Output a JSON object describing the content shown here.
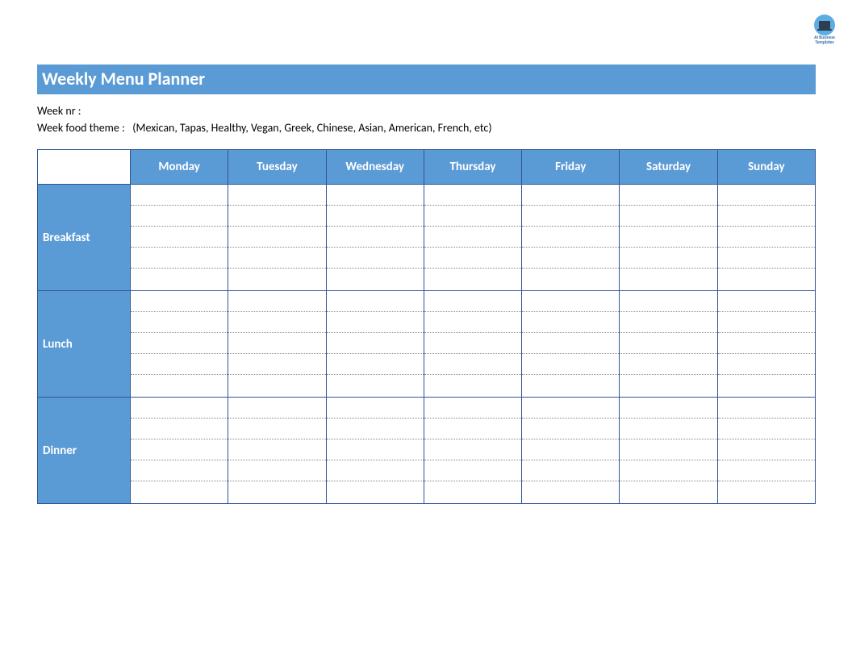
{
  "logo": {
    "line1": "AI Business",
    "line2": "Templates"
  },
  "title": "Weekly Menu Planner",
  "meta": {
    "week_nr_label": "Week nr :",
    "theme_label": "Week food theme :",
    "theme_hint": "(Mexican, Tapas, Healthy, Vegan, Greek, Chinese, Asian, American, French, etc)"
  },
  "days": [
    "Monday",
    "Tuesday",
    "Wednesday",
    "Thursday",
    "Friday",
    "Saturday",
    "Sunday"
  ],
  "meals": [
    "Breakfast",
    "Lunch",
    "Dinner"
  ],
  "lines_per_cell": 5
}
